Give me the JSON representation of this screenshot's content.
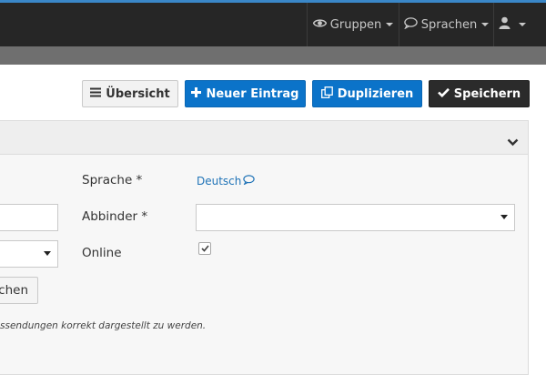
{
  "topbar": {
    "nav": [
      {
        "label": "Gruppen",
        "icon": "eye-icon"
      },
      {
        "label": "Sprachen",
        "icon": "speech-bubble-icon"
      },
      {
        "label": "",
        "icon": "user-icon"
      }
    ]
  },
  "toolbar": {
    "overview_label": "Übersicht",
    "new_entry_label": "Neuer Eintrag",
    "duplicate_label": "Duplizieren",
    "save_label": "Speichern"
  },
  "form": {
    "sprache_label": "Sprache *",
    "sprache_value": "Deutsch",
    "abbinder_label": "Abbinder *",
    "abbinder_value": "",
    "online_label": "Online",
    "online_checked": true,
    "left_button_label": "chen",
    "hint_text": "ssendungen korrekt dargestellt zu werden."
  },
  "colors": {
    "accent": "#3a87c8",
    "primary": "#0b73c9",
    "dark": "#2b2b2b"
  }
}
